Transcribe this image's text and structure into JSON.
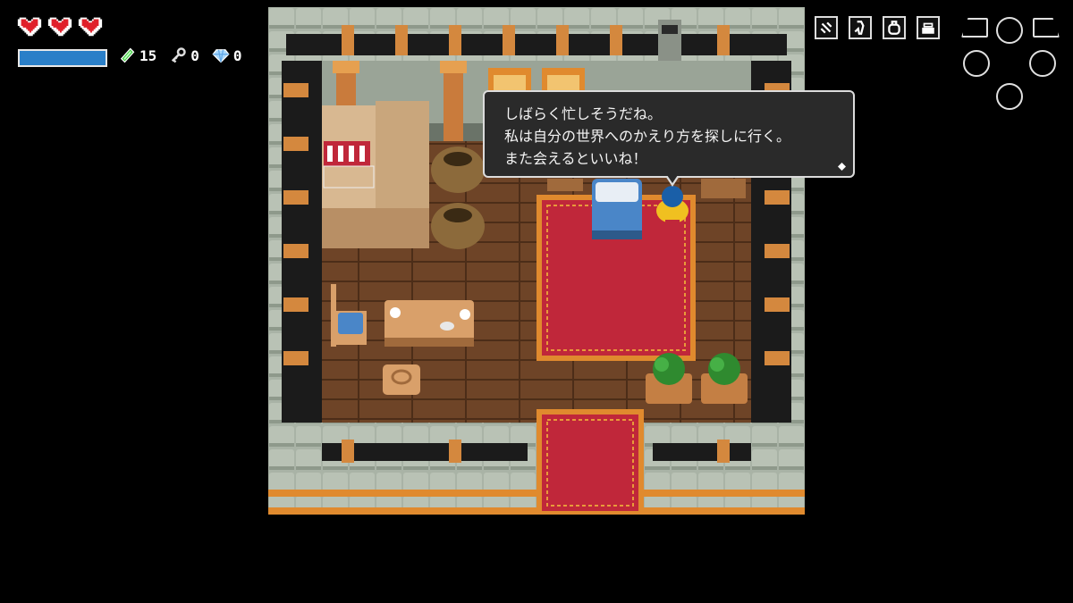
{
  "hud": {
    "hearts": {
      "filled": 3,
      "total": 3
    },
    "stamina": {
      "fraction": 1.0
    },
    "counters": [
      {
        "icon": "rupee-icon",
        "value": "15"
      },
      {
        "icon": "key-icon",
        "value": "0"
      },
      {
        "icon": "diamond-icon",
        "value": "0"
      }
    ],
    "toolbar": [
      "sword-icon",
      "tool-icon",
      "item-icon",
      "bag-icon",
      "map-icon"
    ],
    "colors": {
      "heart": "#e0202a",
      "stamina": "#2a7fc8",
      "rupee": "#3ecb3e",
      "diamond": "#a8d8ff"
    }
  },
  "dialog": {
    "lines": [
      "しばらく忙しそうだね。",
      "私は自分の世界へのかえり方を探しに行く。",
      "また会えるといいね！"
    ]
  },
  "scene": {
    "colors": {
      "stone": "#a9b3a6",
      "stone_dark": "#7e8a7b",
      "floor": "#6e4427",
      "carpet": "#c0273a",
      "carpet_border": "#e08a2e",
      "pillar": "#c97b3c"
    }
  }
}
